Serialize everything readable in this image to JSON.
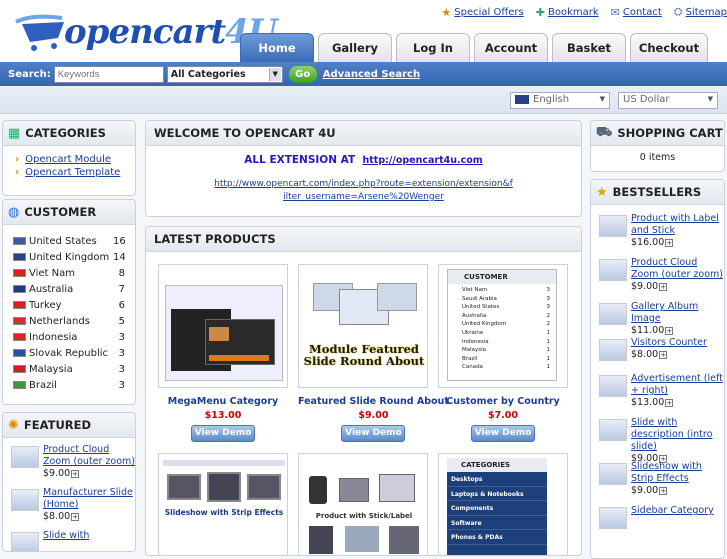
{
  "header": {
    "logo_main": "opencart",
    "logo_accent": "4U",
    "top_links": [
      {
        "label": "Special Offers",
        "icon": "star-icon"
      },
      {
        "label": "Bookmark",
        "icon": "bookmark-icon"
      },
      {
        "label": "Contact",
        "icon": "mail-icon"
      },
      {
        "label": "Sitemap",
        "icon": "sitemap-icon"
      }
    ],
    "tabs": [
      "Home",
      "Gallery",
      "Log In",
      "Account",
      "Basket",
      "Checkout"
    ],
    "active_tab": "Home"
  },
  "search": {
    "label": "Search:",
    "placeholder": "Keywords",
    "category": "All Categories",
    "go": "Go",
    "advanced": "Advanced Search"
  },
  "subbar": {
    "language": "English",
    "currency": "US Dollar"
  },
  "categories": {
    "title": "CATEGORIES",
    "items": [
      "Opencart Module",
      "Opencart Template"
    ]
  },
  "customer": {
    "title": "CUSTOMER",
    "rows": [
      {
        "country": "United States",
        "count": "16",
        "flag": "#3a5aa8"
      },
      {
        "country": "United Kingdom",
        "count": "14",
        "flag": "#2b3f8c"
      },
      {
        "country": "Viet Nam",
        "count": "8",
        "flag": "#d6241c"
      },
      {
        "country": "Australia",
        "count": "7",
        "flag": "#1f3c8a"
      },
      {
        "country": "Turkey",
        "count": "6",
        "flag": "#d8201e"
      },
      {
        "country": "Netherlands",
        "count": "5",
        "flag": "#c33"
      },
      {
        "country": "Indonesia",
        "count": "3",
        "flag": "#d22"
      },
      {
        "country": "Slovak Republic",
        "count": "3",
        "flag": "#2a4fa8"
      },
      {
        "country": "Malaysia",
        "count": "3",
        "flag": "#c22"
      },
      {
        "country": "Brazil",
        "count": "3",
        "flag": "#3a9a3a"
      }
    ]
  },
  "featured": {
    "title": "FEATURED",
    "items": [
      {
        "name": "Product Cloud Zoom (outer zoom)",
        "price": "$9.00"
      },
      {
        "name": "Manufacturer Slide (Home)",
        "price": "$8.00"
      },
      {
        "name": "Slide with",
        "price": ""
      }
    ]
  },
  "welcome": {
    "title": "WELCOME TO OPENCART 4U",
    "headline": "ALL EXTENSION AT",
    "headline_link": "http://opencart4u.com",
    "url": "http://www.opencart.com/index.php?route=extension/extension&filter_username=Arsene%20Wenger"
  },
  "latest": {
    "title": "LATEST PRODUCTS",
    "button": "View Demo",
    "products": [
      {
        "name": "MegaMenu Category",
        "price": "$13.00"
      },
      {
        "name": "Featured Slide Round About",
        "price": "$9.00"
      },
      {
        "name": "Customer by Country",
        "price": "$7.00"
      },
      {
        "name": "Slideshow with Strip Effects",
        "price": ""
      },
      {
        "name": "Product with Stick/Label",
        "price": ""
      },
      {
        "name": "Sidebar Category",
        "price": ""
      }
    ],
    "thumb_text": {
      "p2": "Module Featured Slide Round About",
      "p3_title": "CUSTOMER",
      "p4": "Slideshow with Strip Effects",
      "p5": "Product with Stick/Label",
      "p6_title": "CATEGORIES",
      "p6_items": [
        "Desktops",
        "Laptops & Notebooks",
        "Components",
        "Software",
        "Phones & PDAs"
      ],
      "p3_rows": [
        {
          "c": "Viet Nam",
          "n": "3"
        },
        {
          "c": "Saudi Arabia",
          "n": "3"
        },
        {
          "c": "United States",
          "n": "3"
        },
        {
          "c": "Australia",
          "n": "2"
        },
        {
          "c": "United Kingdom",
          "n": "2"
        },
        {
          "c": "Ukraine",
          "n": "1"
        },
        {
          "c": "Indonesia",
          "n": "1"
        },
        {
          "c": "Malaysia",
          "n": "1"
        },
        {
          "c": "Brazil",
          "n": "1"
        },
        {
          "c": "Canada",
          "n": "1"
        }
      ]
    }
  },
  "cart": {
    "title": "SHOPPING CART",
    "text": "0 items"
  },
  "bestsellers": {
    "title": "BESTSELLERS",
    "items": [
      {
        "name": "Product with Label and Stick",
        "price": "$16.00"
      },
      {
        "name": "Product Cloud Zoom (outer zoom)",
        "price": "$9.00"
      },
      {
        "name": "Gallery Album Image",
        "price": "$11.00"
      },
      {
        "name": "Visitors Counter",
        "price": "$8.00"
      },
      {
        "name": "Advertisement (left + right)",
        "price": "$13.00"
      },
      {
        "name": "Slide with description (intro slide)",
        "price": "$9.00"
      },
      {
        "name": "Slideshow with Strip Effects",
        "price": "$9.00"
      },
      {
        "name": "Sidebar Category",
        "price": ""
      }
    ]
  },
  "colors": {
    "accent": "#3b6cb8",
    "price": "#cc0000",
    "link": "#1a3d9a"
  }
}
